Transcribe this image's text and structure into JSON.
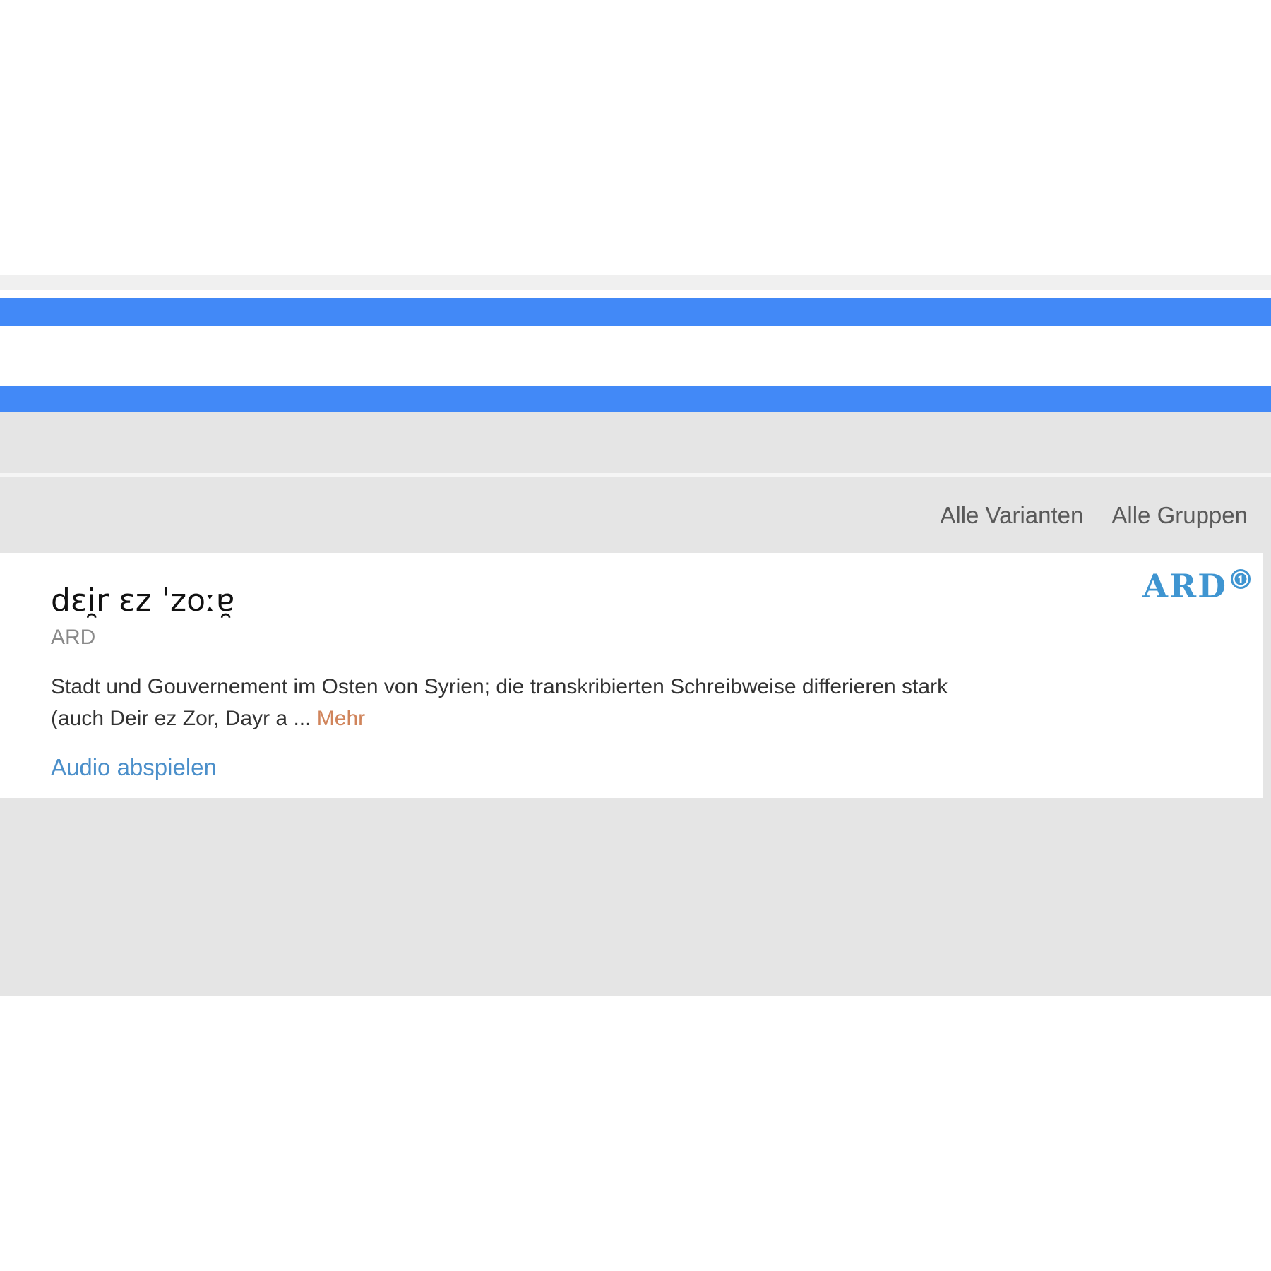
{
  "filters": {
    "all_variants": "Alle Varianten",
    "all_groups": "Alle Gruppen"
  },
  "result": {
    "pronunciation": "dɛi̯r ɛz ˈzoːɐ̯",
    "source": "ARD",
    "description": "Stadt und Gouvernement im Osten von Syrien; die transkribierten Schreibweise differieren stark (auch Deir ez Zor, Dayr a ...",
    "more_label": "Mehr",
    "audio_label": "Audio abspielen",
    "logo_text": "ARD",
    "logo_icon": "ard-one-icon"
  },
  "colors": {
    "blue_bar": "#4289f7",
    "link_blue": "#4b8fca",
    "more_orange": "#d0845b",
    "logo_blue": "#3f95d1",
    "background_grey": "#e5e5e5"
  }
}
